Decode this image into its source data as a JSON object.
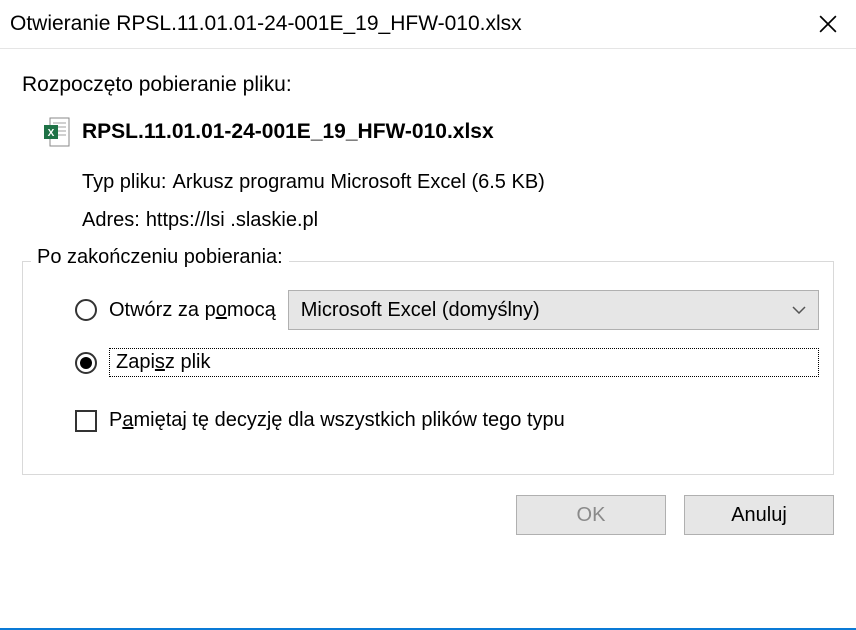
{
  "titlebar": {
    "title": "Otwieranie RPSL.11.01.01-24-001E_19_HFW-010.xlsx"
  },
  "intro": "Rozpoczęto pobieranie pliku:",
  "file": {
    "name": "RPSL.11.01.01-24-001E_19_HFW-010.xlsx",
    "type_label": "Typ pliku:",
    "type_value": "Arkusz programu Microsoft Excel (6.5 KB)",
    "address_label": "Adres:",
    "address_value": "https://lsi .slaskie.pl"
  },
  "fieldset": {
    "legend": "Po zakończeniu pobierania:",
    "open_with_pre": "Otwórz za p",
    "open_with_u": "o",
    "open_with_post": "mocą",
    "open_with_app": "Microsoft Excel (domyślny)",
    "save_pre": "Zapi",
    "save_u": "s",
    "save_post": "z plik",
    "remember_pre": "P",
    "remember_u": "a",
    "remember_post": "miętaj tę decyzję dla wszystkich plików tego typu"
  },
  "buttons": {
    "ok": "OK",
    "cancel": "Anuluj"
  }
}
